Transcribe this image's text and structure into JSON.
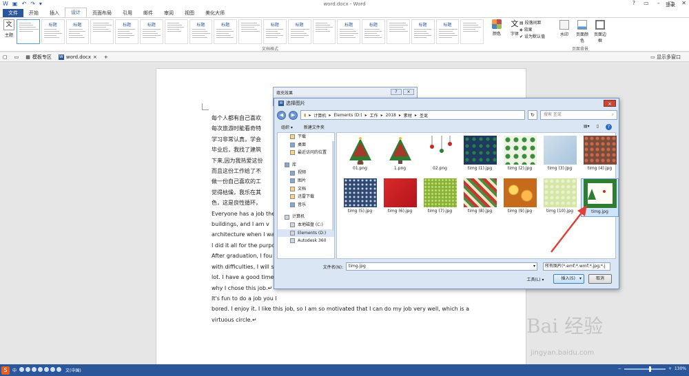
{
  "window": {
    "title": "word.docx - Word",
    "login": "登录"
  },
  "ribbon_tabs": [
    "文件",
    "开始",
    "插入",
    "设计",
    "页面布局",
    "引用",
    "邮件",
    "审阅",
    "视图",
    "美化大师"
  ],
  "ribbon": {
    "theme_label": "主题",
    "gallery_title_text": "标题",
    "gallery_group_label": "文档格式",
    "colors_label": "颜色",
    "fonts_label": "字体",
    "paragraph_spacing": "段落间距",
    "effects": "效果",
    "set_default": "设为默认值",
    "watermark_label": "水印",
    "page_color_label": "页面颜色",
    "page_border_label": "页面边框",
    "page_bg_group_label": "页面背景"
  },
  "doc_tabs": {
    "template_zone": "模板专区",
    "doc_name": "word.docx",
    "add": "+",
    "multi_window": "显示多窗口"
  },
  "document": {
    "text": "每个人都有自己喜欢\n每次旅游时能看奇特\n学习非常认真，学会\n毕业后，我找了建筑\n下来,因为我热爱这份\n而且这份工作给了不\n做一份自己喜欢的工\n觉得枯燥，我乐在其\n色，这是良性循环，\nEveryone has a job the\nbuildings, and I am v\narchitecture when I wa\nI did it all for the purpo\nAfter graduation, I fou\nwith difficulties, I will s\nlot. I have a good time\nwhy I chose this job.↵\nIt's fun to do a job you l\nbored. I enjoy it. I like this job, so I am so motivated that I can do my job very well, which is a\nvirtuous circle.↵"
  },
  "fill_dialog": {
    "title": "填充效果",
    "btn_help": "?",
    "btn_close": "×"
  },
  "picture_dialog": {
    "title": "选择图片",
    "close": "×",
    "path": [
      "计算机",
      "Elements (D:)",
      "工作",
      "2018",
      "素材",
      "圣诞"
    ],
    "search_placeholder": "搜索 圣诞",
    "organize": "组织 ▾",
    "new_folder": "新建文件夹",
    "nav_items": [
      {
        "label": "下载",
        "level": 1,
        "icon": "download-folder-icon"
      },
      {
        "label": "桌面",
        "level": 1,
        "icon": "desktop-icon"
      },
      {
        "label": "最近访问的位置",
        "level": 1,
        "icon": "recent-places-icon"
      },
      {
        "label": "",
        "level": 0,
        "icon": ""
      },
      {
        "label": "库",
        "level": 0,
        "icon": "library-icon"
      },
      {
        "label": "视频",
        "level": 1,
        "icon": "videos-icon"
      },
      {
        "label": "图片",
        "level": 1,
        "icon": "pictures-icon"
      },
      {
        "label": "文档",
        "level": 1,
        "icon": "documents-icon"
      },
      {
        "label": "迅雷下载",
        "level": 1,
        "icon": "thunder-download-icon"
      },
      {
        "label": "音乐",
        "level": 1,
        "icon": "music-icon"
      },
      {
        "label": "",
        "level": 0,
        "icon": ""
      },
      {
        "label": "计算机",
        "level": 0,
        "icon": "computer-icon"
      },
      {
        "label": "本地磁盘 (C:)",
        "level": 1,
        "icon": "drive-c-icon"
      },
      {
        "label": "Elements (D:)",
        "level": 1,
        "icon": "drive-d-icon"
      },
      {
        "label": "Autodesk 360",
        "level": 1,
        "icon": "cloud-icon"
      }
    ],
    "files": [
      {
        "name": "01.png",
        "kind": "tree-red"
      },
      {
        "name": "1.png",
        "kind": "tree-red2"
      },
      {
        "name": "02.png",
        "kind": "ornaments"
      },
      {
        "name": "timg (1).jpg",
        "kind": "navy-pattern"
      },
      {
        "name": "timg (2).jpg",
        "kind": "holly"
      },
      {
        "name": "timg (3).jpg",
        "kind": "light-blue"
      },
      {
        "name": "timg (4).jpg",
        "kind": "brown-dots"
      },
      {
        "name": "timg (5).jpg",
        "kind": "blue-dots"
      },
      {
        "name": "timg (6).jpg",
        "kind": "red"
      },
      {
        "name": "timg (7).jpg",
        "kind": "green-glitter"
      },
      {
        "name": "timg (8).jpg",
        "kind": "stripes"
      },
      {
        "name": "timg (9).jpg",
        "kind": "gold-bokeh"
      },
      {
        "name": "timg (10).jpg",
        "kind": "pale-green"
      },
      {
        "name": "timg.jpg",
        "kind": "card-selected"
      }
    ],
    "filename_label": "文件名(N):",
    "filename_value": "timg.jpg",
    "filetype_value": "所有图片(*.emf;*.wmf;*.jpg;*.j",
    "tools_label": "工具(L)",
    "insert_label": "插入(S)",
    "cancel_label": "取消"
  },
  "watermark": {
    "brand": "Bai 经验",
    "url": "jingyan.baidu.com"
  },
  "statusbar": {
    "ime": "中",
    "lang": "文(中国)",
    "zoom": "130%"
  },
  "colors": {
    "accent": "#2b579a",
    "dialog_bg": "#dbe6f4",
    "arrow": "#e0403a"
  }
}
